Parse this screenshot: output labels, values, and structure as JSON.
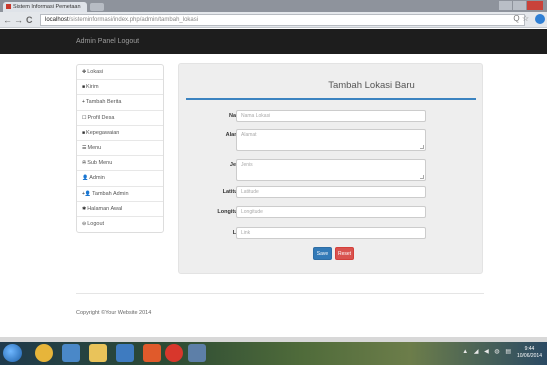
{
  "browser": {
    "tab_title": "Sistem Informasi Pemetaan",
    "url_host": "localhost",
    "url_path": "/sisteminformasi/index.php/admin/tambah_lokasi",
    "nav_back": "←",
    "nav_forward": "→",
    "nav_reload": "C",
    "omni_icons": "Q ☆"
  },
  "app": {
    "brand": "Admin Panel     Logout"
  },
  "sidebar": {
    "items": [
      {
        "icon": "✥",
        "label": "Lokasi"
      },
      {
        "icon": "■",
        "label": "Kirim"
      },
      {
        "icon": "+",
        "label": "Tambah Berita"
      },
      {
        "icon": "☐",
        "label": "Profil Desa"
      },
      {
        "icon": "■",
        "label": "Kepegawaian"
      },
      {
        "icon": "☰",
        "label": "Menu"
      },
      {
        "icon": "✇",
        "label": "Sub Menu"
      },
      {
        "icon": "👤",
        "label": "Admin"
      },
      {
        "icon": "+👤",
        "label": "Tambah Admin"
      },
      {
        "icon": "✱",
        "label": "Halaman Awal"
      },
      {
        "icon": "⊖",
        "label": "Logout"
      }
    ]
  },
  "form": {
    "title": "Tambah Lokasi Baru",
    "fields": {
      "nama": {
        "label": "Nama",
        "placeholder": "Nama Lokasi"
      },
      "alamat": {
        "label": "Alamat",
        "placeholder": "Alamat"
      },
      "jenis": {
        "label": "Jenis",
        "placeholder": "Jenis"
      },
      "latitude": {
        "label": "Latitude",
        "placeholder": "Latitude"
      },
      "longitude": {
        "label": "Longitude",
        "placeholder": "Longitude"
      },
      "link": {
        "label": "Link",
        "placeholder": "Link"
      }
    },
    "save_label": "Save",
    "reset_label": "Reset"
  },
  "footer": {
    "text": "Copyright ©Your Website 2014"
  },
  "taskbar": {
    "tray_icons": "▲ ◢ ◀ ◍ ▤",
    "time": "9:44",
    "date": "10/06/2014"
  },
  "colors": {
    "accent": "#3b83c0",
    "save": "#337ab7",
    "reset": "#d9534f",
    "navbar": "#1d1d1d"
  }
}
